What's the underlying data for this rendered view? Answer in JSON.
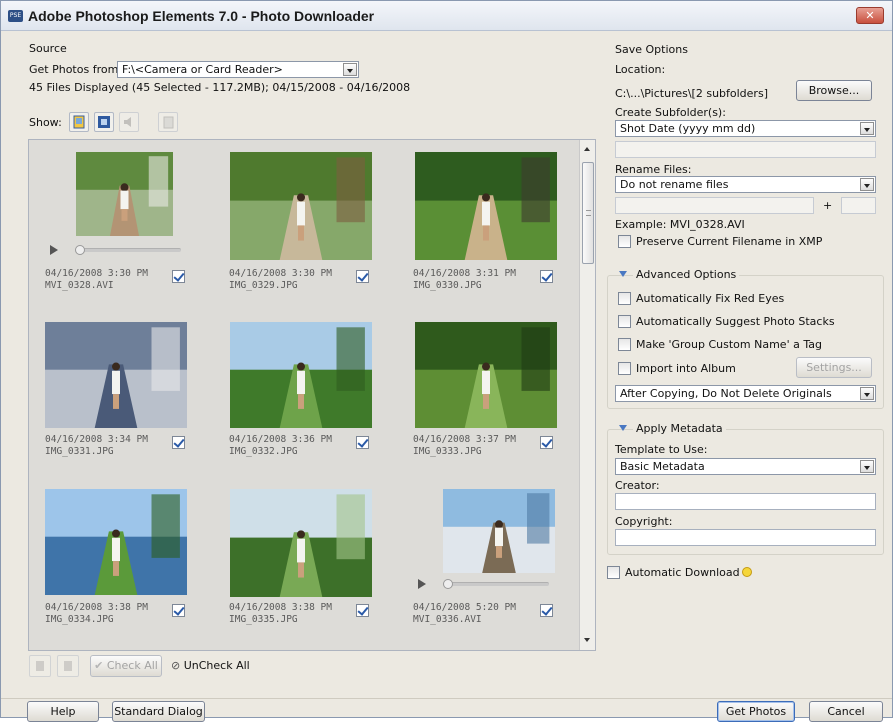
{
  "window": {
    "title": "Adobe Photoshop Elements 7.0 - Photo Downloader",
    "app_icon": "PSE",
    "close_glyph": "✕"
  },
  "source": {
    "heading": "Source",
    "get_from_label": "Get Photos from:",
    "get_from_value": "F:\\<Camera or Card Reader>",
    "summary": "45 Files Displayed (45 Selected - 117.2MB); 04/15/2008 - 04/16/2008"
  },
  "show": {
    "label": "Show:"
  },
  "items": [
    {
      "date": "04/16/2008 3:30 PM",
      "name": "MVI_0328.AVI",
      "checked": true,
      "video": true,
      "palette": "stairs"
    },
    {
      "date": "04/16/2008 3:30 PM",
      "name": "IMG_0329.JPG",
      "checked": true,
      "video": false,
      "palette": "stairs2"
    },
    {
      "date": "04/16/2008 3:31 PM",
      "name": "IMG_0330.JPG",
      "checked": true,
      "video": false,
      "palette": "jungle"
    },
    {
      "date": "04/16/2008 3:34 PM",
      "name": "IMG_0331.JPG",
      "checked": true,
      "video": false,
      "palette": "steps"
    },
    {
      "date": "04/16/2008 3:36 PM",
      "name": "IMG_0332.JPG",
      "checked": true,
      "video": false,
      "palette": "field"
    },
    {
      "date": "04/16/2008 3:37 PM",
      "name": "IMG_0333.JPG",
      "checked": true,
      "video": false,
      "palette": "forest"
    },
    {
      "date": "04/16/2008 3:38 PM",
      "name": "IMG_0334.JPG",
      "checked": true,
      "video": false,
      "palette": "sea"
    },
    {
      "date": "04/16/2008 3:38 PM",
      "name": "IMG_0335.JPG",
      "checked": true,
      "video": false,
      "palette": "meadow"
    },
    {
      "date": "04/16/2008 5:20 PM",
      "name": "MVI_0336.AVI",
      "checked": true,
      "video": true,
      "palette": "shore"
    }
  ],
  "bottom_toolbar": {
    "check_all": "Check All",
    "uncheck_all": "UnCheck All"
  },
  "save_options": {
    "heading": "Save Options",
    "location_label": "Location:",
    "location_value": "C:\\...\\Pictures\\[2 subfolders]",
    "browse": "Browse...",
    "create_subfolders_label": "Create Subfolder(s):",
    "create_subfolders_value": "Shot Date (yyyy mm dd)",
    "rename_label": "Rename Files:",
    "rename_value": "Do not rename files",
    "plus": "+",
    "example": "Example:  MVI_0328.AVI",
    "preserve": "Preserve Current Filename in XMP"
  },
  "advanced": {
    "heading": "Advanced Options",
    "fix_red_eyes": "Automatically Fix Red Eyes",
    "suggest_stacks": "Automatically Suggest Photo Stacks",
    "group_tag": "Make 'Group Custom Name' a Tag",
    "import_album": "Import into Album",
    "settings": "Settings...",
    "after_copying": "After Copying, Do Not Delete Originals"
  },
  "metadata": {
    "heading": "Apply Metadata",
    "template_label": "Template to Use:",
    "template_value": "Basic Metadata",
    "creator_label": "Creator:",
    "copyright_label": "Copyright:"
  },
  "automatic_download": "Automatic Download",
  "footer": {
    "help": "Help",
    "standard_dialog": "Standard Dialog",
    "get_photos": "Get Photos",
    "cancel": "Cancel"
  }
}
